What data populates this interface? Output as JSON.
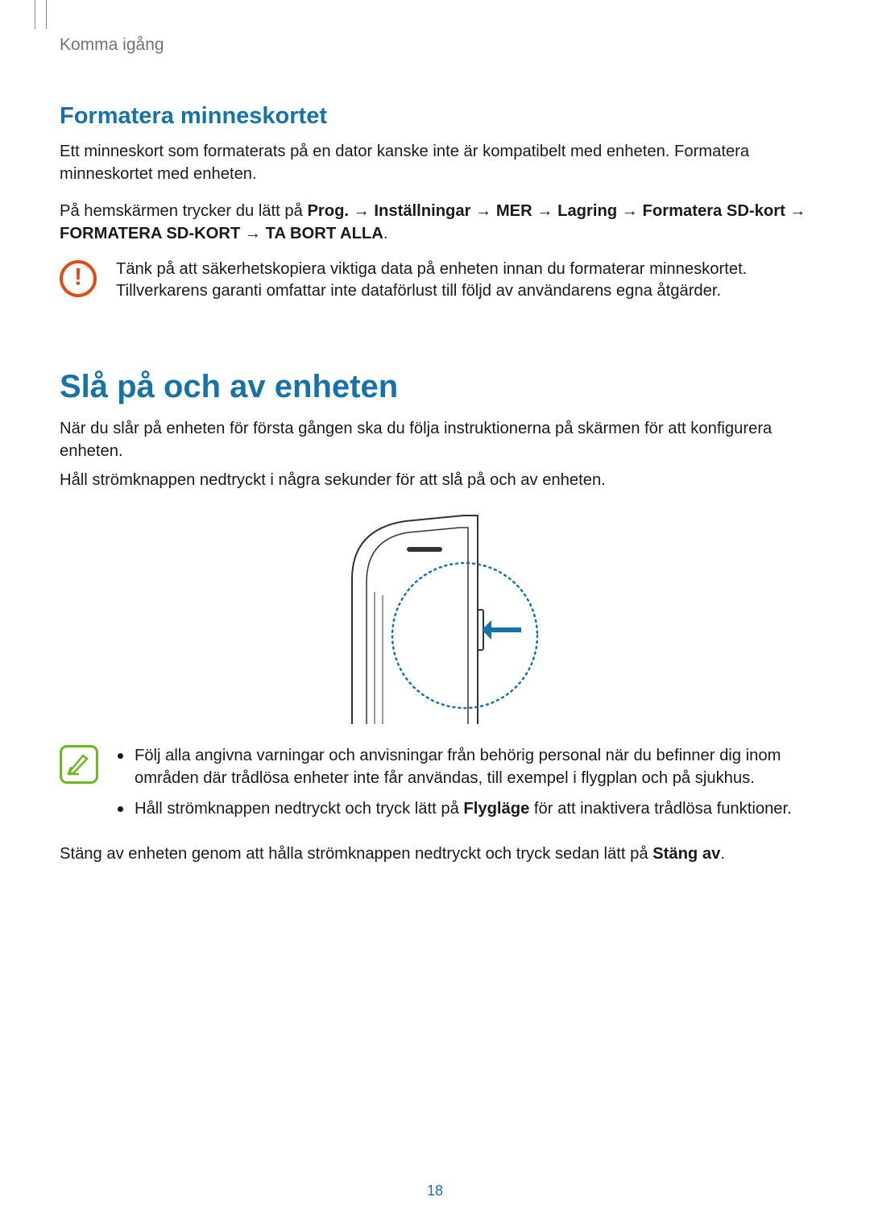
{
  "chapter": "Komma igång",
  "format": {
    "title": "Formatera minneskortet",
    "p1": "Ett minneskort som formaterats på en dator kanske inte är kompatibelt med enheten. Formatera minneskortet med enheten.",
    "p2_prefix": "På hemskärmen trycker du lätt på ",
    "p2_path": "Prog. → Inställningar → MER → Lagring → Formatera SD-kort → FORMATERA SD-KORT → TA BORT ALLA",
    "p2_suffix": ".",
    "warn": "Tänk på att säkerhetskopiera viktiga data på enheten innan du formaterar minneskortet. Tillverkarens garanti omfattar inte dataförlust till följd av användarens egna åtgärder."
  },
  "power": {
    "title": "Slå på och av enheten",
    "p1": "När du slår på enheten för första gången ska du följa instruktionerna på skärmen för att konfigurera enheten.",
    "p2": "Håll strömknappen nedtryckt i några sekunder för att slå på och av enheten.",
    "note1": "Följ alla angivna varningar och anvisningar från behörig personal när du befinner dig inom områden där trådlösa enheter inte får användas, till exempel i flygplan och på sjukhus.",
    "note2_prefix": "Håll strömknappen nedtryckt och tryck lätt på ",
    "note2_bold": "Flygläge",
    "note2_suffix": " för att inaktivera trådlösa funktioner.",
    "p3_prefix": "Stäng av enheten genom att hålla strömknappen nedtryckt och tryck sedan lätt på ",
    "p3_bold": "Stäng av",
    "p3_suffix": "."
  },
  "page_number": "18"
}
